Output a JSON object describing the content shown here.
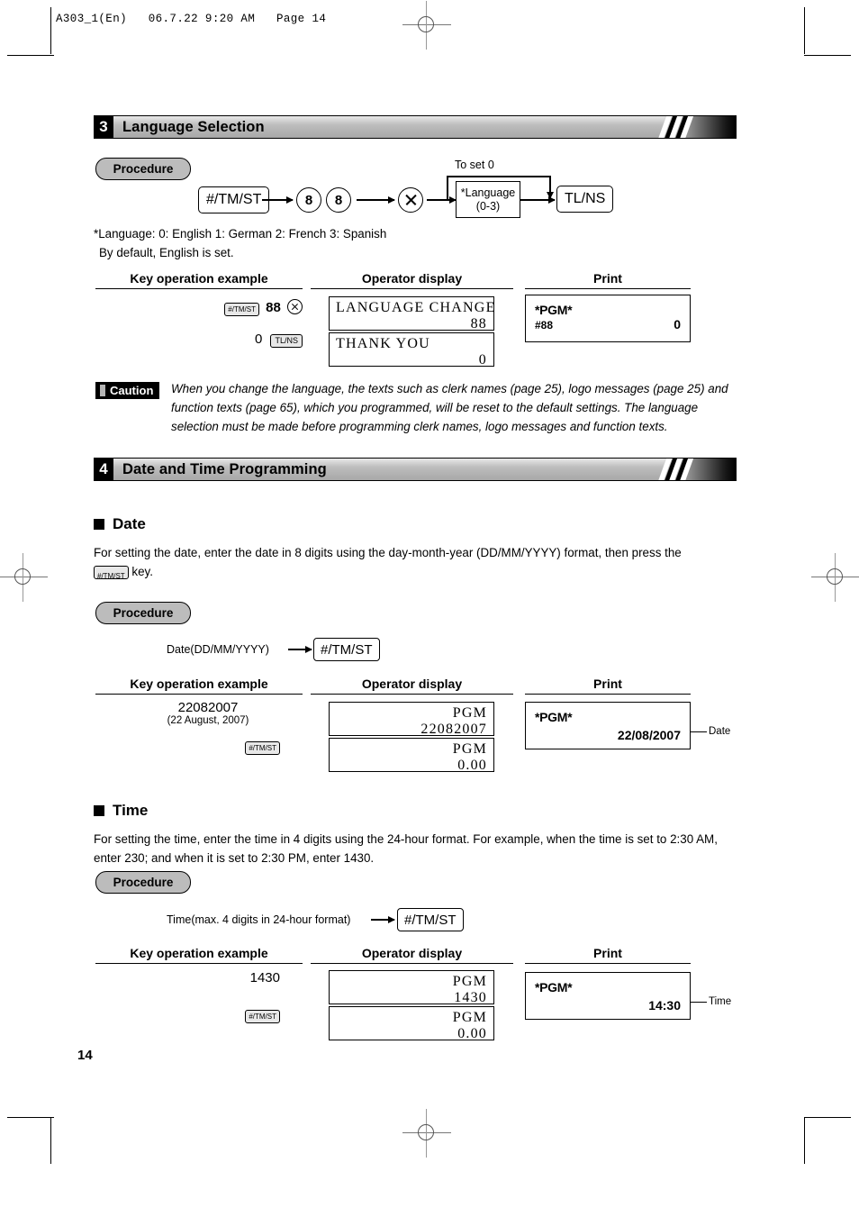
{
  "page": {
    "header_line": "A303_1(En)   06.7.22 9:20 AM   Page 14",
    "page_number": "14"
  },
  "section3": {
    "number": "3",
    "title": "Language Selection",
    "procedure_label": "Procedure",
    "flow": {
      "key1": "#/TM/ST",
      "digit1": "8",
      "digit2": "8",
      "multiply_icon": "multiply-icon",
      "box_line1": "*Language",
      "box_line2": "(0-3)",
      "bypass_label": "To set  0",
      "key_last": "TL/NS"
    },
    "note_line1": "*Language: 0: English      1: German       2: French       3: Spanish",
    "note_line2": "By default, English is set.",
    "languages": [
      {
        "code": "0",
        "name": "English"
      },
      {
        "code": "1",
        "name": "German"
      },
      {
        "code": "2",
        "name": "French"
      },
      {
        "code": "3",
        "name": "Spanish"
      }
    ],
    "table": {
      "col1": "Key operation example",
      "col2": "Operator display",
      "col3": "Print",
      "keyop_row1_key": "#/TM/ST",
      "keyop_row1_value": "88",
      "keyop_row2_value": "0",
      "keyop_row2_key": "TL/NS",
      "display1_line1": "LANGUAGE CHANGE",
      "display1_line2": "88",
      "display2_line1": "THANK YOU",
      "display2_line2": "0",
      "receipt_title": "*PGM*",
      "receipt_code": "#88",
      "receipt_value": "0"
    },
    "caution_label": "Caution",
    "caution_text": "When you change the language, the texts such as clerk names (page 25), logo messages (page 25) and function texts (page 65), which you programmed, will be reset to the default settings.  The language selection must be made before programming clerk names, logo messages and function texts."
  },
  "section4": {
    "number": "4",
    "title": "Date and Time Programming",
    "date": {
      "heading": "Date",
      "description_part1": "For setting the date, enter the date in 8 digits using the day-month-year (DD/MM/YYYY) format, then press the",
      "inline_key": "#/TM/ST",
      "description_part2": "key.",
      "procedure_label": "Procedure",
      "flow_label": "Date(DD/MM/YYYY)",
      "flow_key": "#/TM/ST",
      "table": {
        "col1": "Key operation example",
        "col2": "Operator display",
        "col3": "Print",
        "keyop_value": "22082007",
        "keyop_sub": "(22 August, 2007)",
        "keyop_key": "#/TM/ST",
        "display1_line1": "PGM",
        "display1_line2": "22082007",
        "display2_line1": "PGM",
        "display2_line2": "0.00",
        "receipt_title": "*PGM*",
        "receipt_value": "22/08/2007",
        "callout": "Date"
      }
    },
    "time": {
      "heading": "Time",
      "description": "For setting the time, enter the time in 4 digits using the 24-hour format.  For example, when the time is set to 2:30 AM, enter 230; and when it is set to 2:30 PM, enter 1430.",
      "procedure_label": "Procedure",
      "flow_label": "Time(max. 4 digits in 24-hour format)",
      "flow_key": "#/TM/ST",
      "table": {
        "col1": "Key operation example",
        "col2": "Operator display",
        "col3": "Print",
        "keyop_value": "1430",
        "keyop_key": "#/TM/ST",
        "display1_line1": "PGM",
        "display1_line2": "1430",
        "display2_line1": "PGM",
        "display2_line2": "0.00",
        "receipt_title": "*PGM*",
        "receipt_value": "14:30",
        "callout": "Time"
      }
    }
  }
}
